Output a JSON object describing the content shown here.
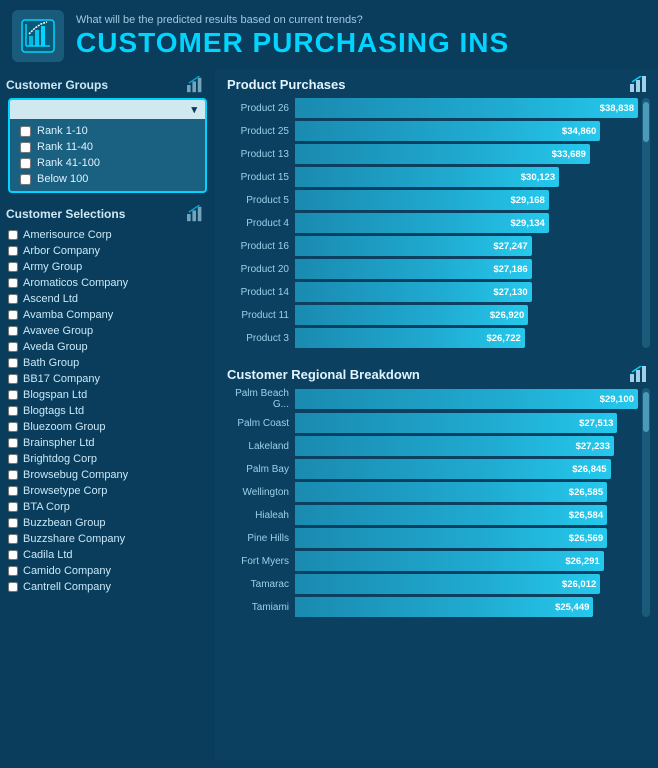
{
  "header": {
    "subtitle": "What will be the predicted results based on current trends?",
    "title": "CUSTOMER PURCHASING INS",
    "icon_label": "chart-icon"
  },
  "sidebar": {
    "groups_section": {
      "title": "Customer Groups",
      "dropdown_header": "",
      "items": [
        {
          "label": "Rank 1-10",
          "checked": false
        },
        {
          "label": "Rank 11-40",
          "checked": false
        },
        {
          "label": "Rank 41-100",
          "checked": false
        },
        {
          "label": "Below 100",
          "checked": false
        }
      ]
    },
    "selections_section": {
      "title": "Customer Selections",
      "items": [
        {
          "label": "Amerisource Corp"
        },
        {
          "label": "Arbor Company"
        },
        {
          "label": "Army Group"
        },
        {
          "label": "Aromaticos Company"
        },
        {
          "label": "Ascend Ltd"
        },
        {
          "label": "Avamba Company"
        },
        {
          "label": "Avavee Group"
        },
        {
          "label": "Aveda Group"
        },
        {
          "label": "Bath Group"
        },
        {
          "label": "BB17 Company"
        },
        {
          "label": "Blogspan Ltd"
        },
        {
          "label": "Blogtags Ltd"
        },
        {
          "label": "Bluezoom Group"
        },
        {
          "label": "Brainspher Ltd"
        },
        {
          "label": "Brightdog Corp"
        },
        {
          "label": "Browsebug Company"
        },
        {
          "label": "Browsetype Corp"
        },
        {
          "label": "BTA Corp"
        },
        {
          "label": "Buzzbean Group"
        },
        {
          "label": "Buzzshare Company"
        },
        {
          "label": "Cadila Ltd"
        },
        {
          "label": "Camido Company"
        },
        {
          "label": "Cantrell Company"
        }
      ]
    }
  },
  "product_purchases": {
    "title": "Product Purchases",
    "bars": [
      {
        "label": "Product 26",
        "value": "$38,838",
        "pct": 100
      },
      {
        "label": "Product 25",
        "value": "$34,860",
        "pct": 89
      },
      {
        "label": "Product 13",
        "value": "$33,689",
        "pct": 86
      },
      {
        "label": "Product 15",
        "value": "$30,123",
        "pct": 77
      },
      {
        "label": "Product 5",
        "value": "$29,168",
        "pct": 74
      },
      {
        "label": "Product 4",
        "value": "$29,134",
        "pct": 74
      },
      {
        "label": "Product 16",
        "value": "$27,247",
        "pct": 69
      },
      {
        "label": "Product 20",
        "value": "$27,186",
        "pct": 69
      },
      {
        "label": "Product 14",
        "value": "$27,130",
        "pct": 69
      },
      {
        "label": "Product 11",
        "value": "$26,920",
        "pct": 68
      },
      {
        "label": "Product 3",
        "value": "$26,722",
        "pct": 67
      }
    ]
  },
  "regional_breakdown": {
    "title": "Customer Regional Breakdown",
    "bars": [
      {
        "label": "Palm Beach G...",
        "value": "$29,100",
        "pct": 100
      },
      {
        "label": "Palm Coast",
        "value": "$27,513",
        "pct": 94
      },
      {
        "label": "Lakeland",
        "value": "$27,233",
        "pct": 93
      },
      {
        "label": "Palm Bay",
        "value": "$26,845",
        "pct": 92
      },
      {
        "label": "Wellington",
        "value": "$26,585",
        "pct": 91
      },
      {
        "label": "Hialeah",
        "value": "$26,584",
        "pct": 91
      },
      {
        "label": "Pine Hills",
        "value": "$26,569",
        "pct": 91
      },
      {
        "label": "Fort Myers",
        "value": "$26,291",
        "pct": 90
      },
      {
        "label": "Tamarac",
        "value": "$26,012",
        "pct": 89
      },
      {
        "label": "Tamiami",
        "value": "$25,449",
        "pct": 87
      }
    ]
  }
}
